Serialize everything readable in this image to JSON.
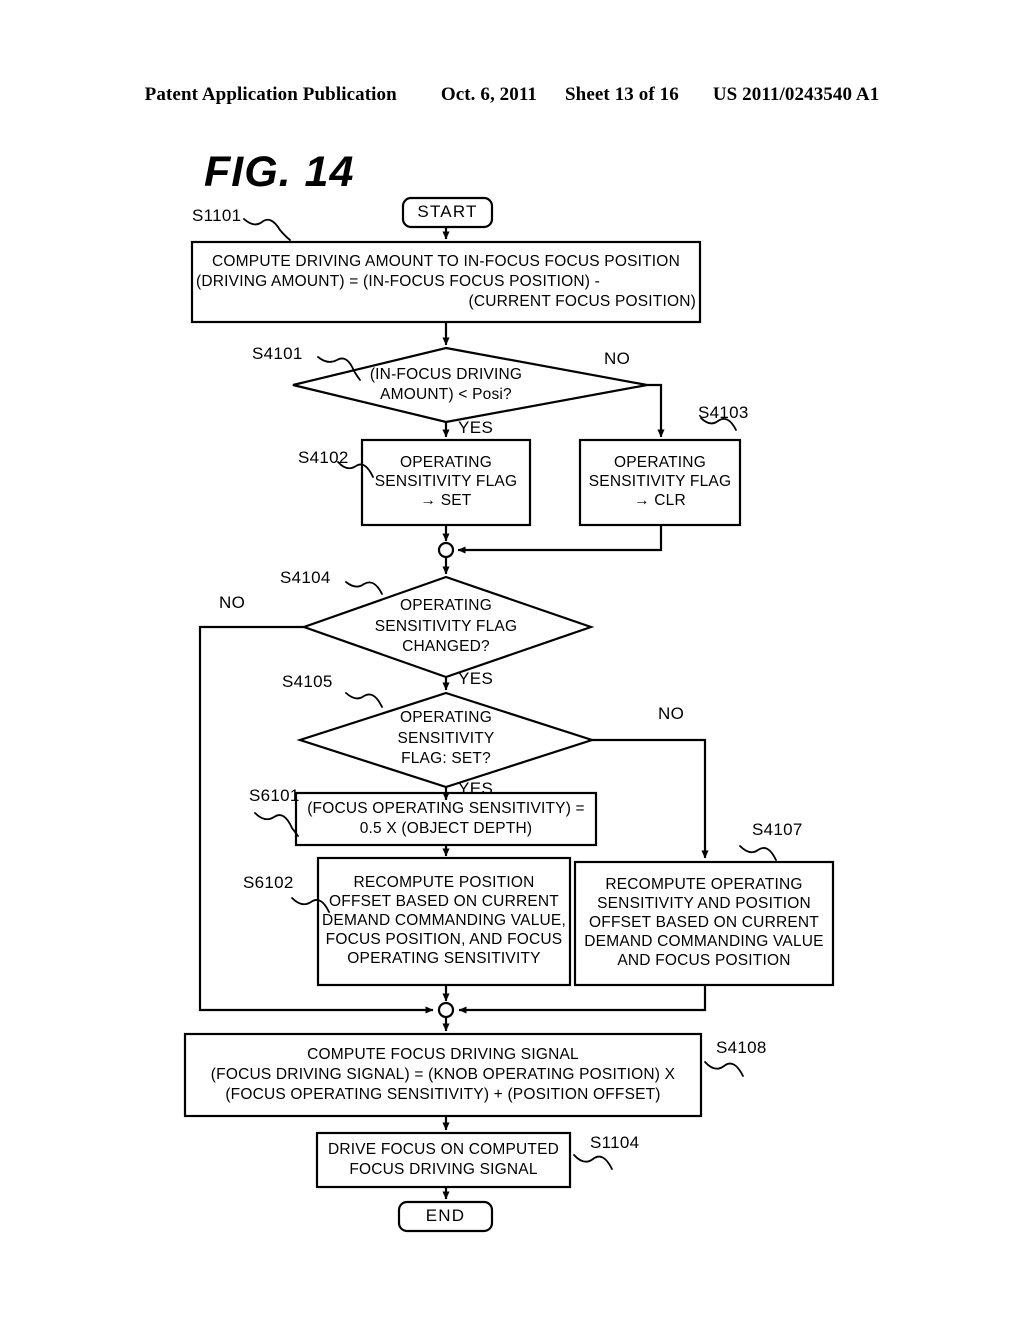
{
  "header": {
    "publication": "Patent Application Publication",
    "date": "Oct. 6, 2011",
    "sheet": "Sheet 13 of 16",
    "number": "US 2011/0243540 A1"
  },
  "figure": {
    "title": "FIG. 14"
  },
  "nodes": {
    "start": {
      "label": "START"
    },
    "end": {
      "label": "END"
    },
    "s1101": {
      "tag": "S1101",
      "line1": "COMPUTE DRIVING AMOUNT TO IN-FOCUS FOCUS POSITION",
      "line2": "(DRIVING AMOUNT) = (IN-FOCUS FOCUS POSITION) -",
      "line3": "(CURRENT FOCUS POSITION)"
    },
    "s4101": {
      "tag": "S4101",
      "line1": "(IN-FOCUS DRIVING",
      "line2": "AMOUNT) < Posi?",
      "yes": "YES",
      "no": "NO"
    },
    "s4102": {
      "tag": "S4102",
      "line1": "OPERATING",
      "line2": "SENSITIVITY FLAG",
      "line3": "→ SET"
    },
    "s4103": {
      "tag": "S4103",
      "line1": "OPERATING",
      "line2": "SENSITIVITY FLAG",
      "line3": "→ CLR"
    },
    "s4104": {
      "tag": "S4104",
      "line1": "OPERATING",
      "line2": "SENSITIVITY FLAG",
      "line3": "CHANGED?",
      "yes": "YES",
      "no": "NO"
    },
    "s4105": {
      "tag": "S4105",
      "line1": "OPERATING",
      "line2": "SENSITIVITY",
      "line3": "FLAG: SET?",
      "yes": "YES",
      "no": "NO"
    },
    "s6101": {
      "tag": "S6101",
      "line1": "(FOCUS OPERATING SENSITIVITY) =",
      "line2": "0.5 X (OBJECT DEPTH)"
    },
    "s6102": {
      "tag": "S6102",
      "line1": "RECOMPUTE POSITION",
      "line2": "OFFSET BASED ON CURRENT",
      "line3": "DEMAND COMMANDING VALUE,",
      "line4": "FOCUS POSITION, AND FOCUS",
      "line5": "OPERATING SENSITIVITY"
    },
    "s4107": {
      "tag": "S4107",
      "line1": "RECOMPUTE OPERATING",
      "line2": "SENSITIVITY AND POSITION",
      "line3": "OFFSET BASED ON CURRENT",
      "line4": "DEMAND COMMANDING VALUE",
      "line5": "AND FOCUS POSITION"
    },
    "s4108": {
      "tag": "S4108",
      "line1": "COMPUTE FOCUS DRIVING SIGNAL",
      "line2": "(FOCUS DRIVING SIGNAL) = (KNOB OPERATING POSITION) X",
      "line3": "(FOCUS OPERATING SENSITIVITY) + (POSITION OFFSET)"
    },
    "s1104": {
      "tag": "S1104",
      "line1": "DRIVE FOCUS ON COMPUTED",
      "line2": "FOCUS DRIVING SIGNAL"
    }
  },
  "colors": {
    "stroke": "#000000",
    "background": "#ffffff"
  }
}
